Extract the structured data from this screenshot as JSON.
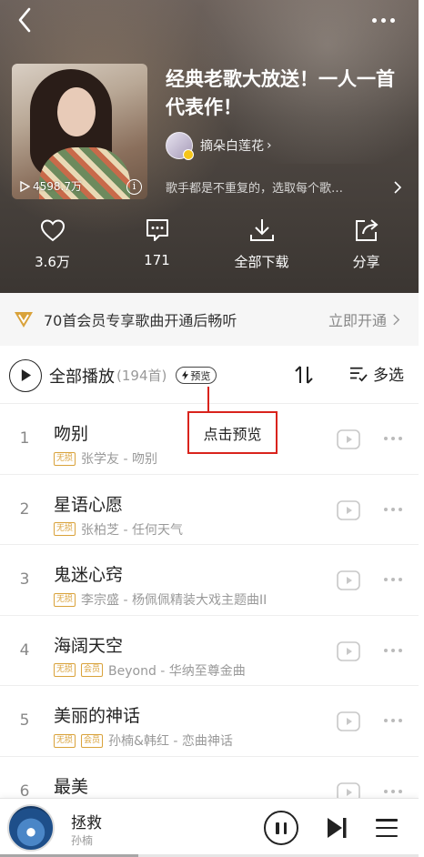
{
  "header": {
    "playlist_title": "经典老歌大放送！一人一首代表作！",
    "creator_name": "摘朵白莲花",
    "creator_chevron": "›",
    "description": "歌手都是不重复的，选取每个歌…",
    "play_count": "4598.7万",
    "actions": [
      {
        "id": "like",
        "label": "3.6万",
        "icon": "heart-icon"
      },
      {
        "id": "comment",
        "label": "171",
        "icon": "comment-icon"
      },
      {
        "id": "download",
        "label": "全部下载",
        "icon": "download-icon"
      },
      {
        "id": "share",
        "label": "分享",
        "icon": "share-icon"
      }
    ]
  },
  "vip_banner": {
    "text": "70首会员专享歌曲开通后畅听",
    "button": "立即开通"
  },
  "play_all": {
    "label": "全部播放",
    "count": "(194首)",
    "preview_badge": "预览",
    "multi_select": "多选"
  },
  "annotation": {
    "text": "点击预览"
  },
  "songs": [
    {
      "index": "1",
      "title": "吻别",
      "tags": [
        "无损"
      ],
      "artist_album": "张学友 - 吻别"
    },
    {
      "index": "2",
      "title": "星语心愿",
      "tags": [
        "无损"
      ],
      "artist_album": "张柏芝 - 任何天气"
    },
    {
      "index": "3",
      "title": "鬼迷心窍",
      "tags": [
        "无损"
      ],
      "artist_album": "李宗盛 - 杨佩佩精装大戏主题曲II"
    },
    {
      "index": "4",
      "title": "海阔天空",
      "tags": [
        "无损",
        "会员"
      ],
      "artist_album": "Beyond - 华纳至尊金曲"
    },
    {
      "index": "5",
      "title": "美丽的神话",
      "tags": [
        "无损",
        "会员"
      ],
      "artist_album": "孙楠&韩红 - 恋曲神话"
    },
    {
      "index": "6",
      "title": "最美",
      "tags": [],
      "artist_album": ""
    }
  ],
  "now_playing": {
    "title": "拯救",
    "artist": "孙楠",
    "progress": 0.33
  },
  "colors": {
    "accent_gold": "#d9a23a",
    "annotation_red": "#d9231c"
  }
}
